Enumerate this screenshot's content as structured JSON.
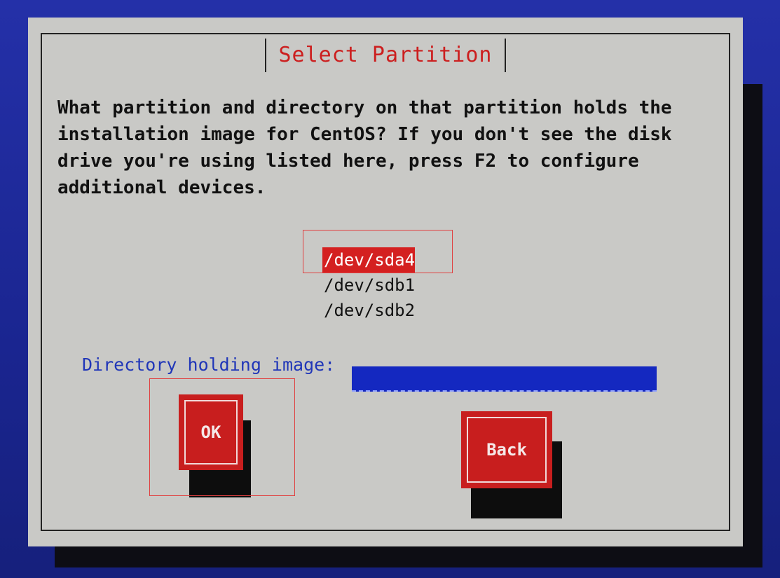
{
  "dialog": {
    "title": "Select Partition",
    "prompt": "What partition and directory on that partition holds the\ninstallation image for CentOS?  If you don't see the disk\ndrive you're using listed here, press F2 to configure\nadditional devices."
  },
  "partitions": {
    "items": [
      "/dev/sda4",
      "/dev/sdb1",
      "/dev/sdb2"
    ],
    "selected": "/dev/sda4"
  },
  "directory": {
    "label": "Directory holding image:",
    "value": ""
  },
  "buttons": {
    "ok_label": "OK",
    "back_label": "Back"
  },
  "colors": {
    "background": "#1c2a9a",
    "dialog": "#c9c9c6",
    "accent_red": "#cc1f1f",
    "label_blue": "#2036b8",
    "input_blue": "#1428c0"
  }
}
